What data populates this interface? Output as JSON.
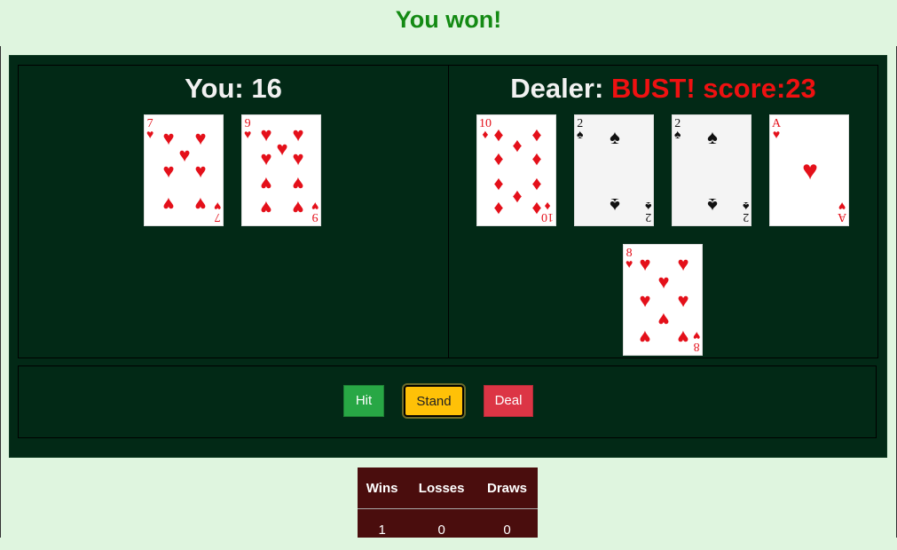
{
  "banner": {
    "text": "You won!"
  },
  "player": {
    "title": "You: 16",
    "cards": [
      {
        "rank": "7",
        "suit": "♥",
        "color": "red"
      },
      {
        "rank": "9",
        "suit": "♥",
        "color": "red"
      }
    ]
  },
  "dealer": {
    "label": "Dealer:",
    "status": "BUST! score:23",
    "cards": [
      {
        "rank": "10",
        "suit": "♦",
        "color": "red"
      },
      {
        "rank": "2",
        "suit": "♠",
        "color": "black"
      },
      {
        "rank": "2",
        "suit": "♠",
        "color": "black"
      },
      {
        "rank": "A",
        "suit": "♥",
        "color": "red"
      },
      {
        "rank": "8",
        "suit": "♥",
        "color": "red"
      }
    ]
  },
  "controls": {
    "hit_label": "Hit",
    "stand_label": "Stand",
    "deal_label": "Deal"
  },
  "stats": {
    "headers": [
      "Wins",
      "Losses",
      "Draws"
    ],
    "values": [
      "1",
      "0",
      "0"
    ]
  },
  "colors": {
    "table_felt": "#022916",
    "win_text": "#138a13",
    "bust_text": "#ee1111"
  }
}
